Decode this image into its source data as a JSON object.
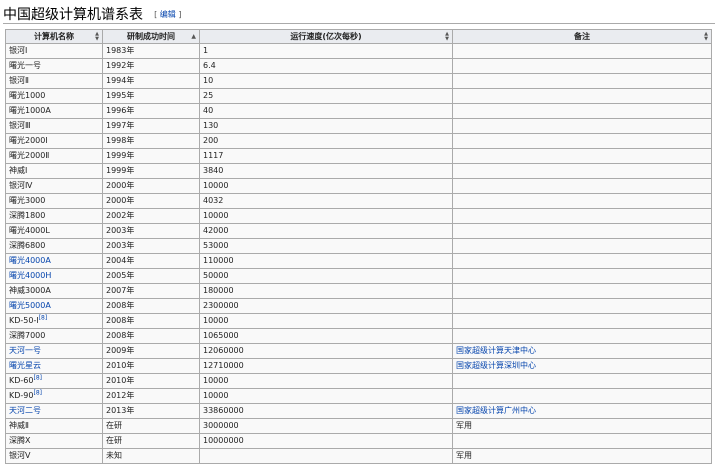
{
  "heading": {
    "title": "中国超级计算机谱系表",
    "edit_open": "[",
    "edit_label": "编辑",
    "edit_close": "]"
  },
  "table": {
    "columns": [
      "计算机名称",
      "研制成功时间",
      "运行速度(亿次每秒)",
      "备注"
    ],
    "sort_icons": [
      "sort-both-icon",
      "sort-ascending-icon",
      "sort-both-icon",
      "sort-both-icon"
    ],
    "rows": [
      {
        "name": "银河Ⅰ",
        "year": "1983年",
        "speed": "1",
        "note": ""
      },
      {
        "name": "曙光一号",
        "year": "1992年",
        "speed": "6.4",
        "note": ""
      },
      {
        "name": "银河Ⅱ",
        "year": "1994年",
        "speed": "10",
        "note": ""
      },
      {
        "name": "曙光1000",
        "year": "1995年",
        "speed": "25",
        "note": ""
      },
      {
        "name": "曙光1000A",
        "year": "1996年",
        "speed": "40",
        "note": ""
      },
      {
        "name": "银河Ⅲ",
        "year": "1997年",
        "speed": "130",
        "note": ""
      },
      {
        "name": "曙光2000Ⅰ",
        "year": "1998年",
        "speed": "200",
        "note": ""
      },
      {
        "name": "曙光2000Ⅱ",
        "year": "1999年",
        "speed": "1117",
        "note": ""
      },
      {
        "name": "神威Ⅰ",
        "year": "1999年",
        "speed": "3840",
        "note": ""
      },
      {
        "name": "银河Ⅳ",
        "year": "2000年",
        "speed": "10000",
        "note": ""
      },
      {
        "name": "曙光3000",
        "year": "2000年",
        "speed": "4032",
        "note": ""
      },
      {
        "name": "深腾1800",
        "year": "2002年",
        "speed": "10000",
        "note": ""
      },
      {
        "name": "曙光4000L",
        "year": "2003年",
        "speed": "42000",
        "note": ""
      },
      {
        "name": "深腾6800",
        "year": "2003年",
        "speed": "53000",
        "note": ""
      },
      {
        "name": "曙光4000A",
        "name_link": true,
        "year": "2004年",
        "speed": "110000",
        "note": ""
      },
      {
        "name": "曙光4000H",
        "name_link": true,
        "year": "2005年",
        "speed": "50000",
        "note": ""
      },
      {
        "name": "神威3000A",
        "year": "2007年",
        "speed": "180000",
        "note": ""
      },
      {
        "name": "曙光5000A",
        "name_link": true,
        "year": "2008年",
        "speed": "2300000",
        "note": ""
      },
      {
        "name": "KD-50-Ⅰ",
        "ref": "[8]",
        "year": "2008年",
        "speed": "10000",
        "note": ""
      },
      {
        "name": "深腾7000",
        "year": "2008年",
        "speed": "1065000",
        "note": ""
      },
      {
        "name": "天河一号",
        "name_link": true,
        "year": "2009年",
        "speed": "12060000",
        "note": "国家超级计算天津中心",
        "note_link": true
      },
      {
        "name": "曙光星云",
        "name_link": true,
        "year": "2010年",
        "speed": "12710000",
        "note": "国家超级计算深圳中心",
        "note_link": true
      },
      {
        "name": "KD-60",
        "ref": "[8]",
        "year": "2010年",
        "speed": "10000",
        "note": ""
      },
      {
        "name": "KD-90",
        "ref": "[8]",
        "year": "2012年",
        "speed": "10000",
        "note": ""
      },
      {
        "name": "天河二号",
        "name_link": true,
        "year": "2013年",
        "speed": "33860000",
        "note": "国家超级计算广州中心",
        "note_link": true
      },
      {
        "name": "神威Ⅱ",
        "year": "在研",
        "speed": "3000000",
        "note": "军用"
      },
      {
        "name": "深腾X",
        "year": "在研",
        "speed": "10000000",
        "note": ""
      },
      {
        "name": "银河Ⅴ",
        "year": "未知",
        "speed": "",
        "note": "军用"
      }
    ]
  }
}
